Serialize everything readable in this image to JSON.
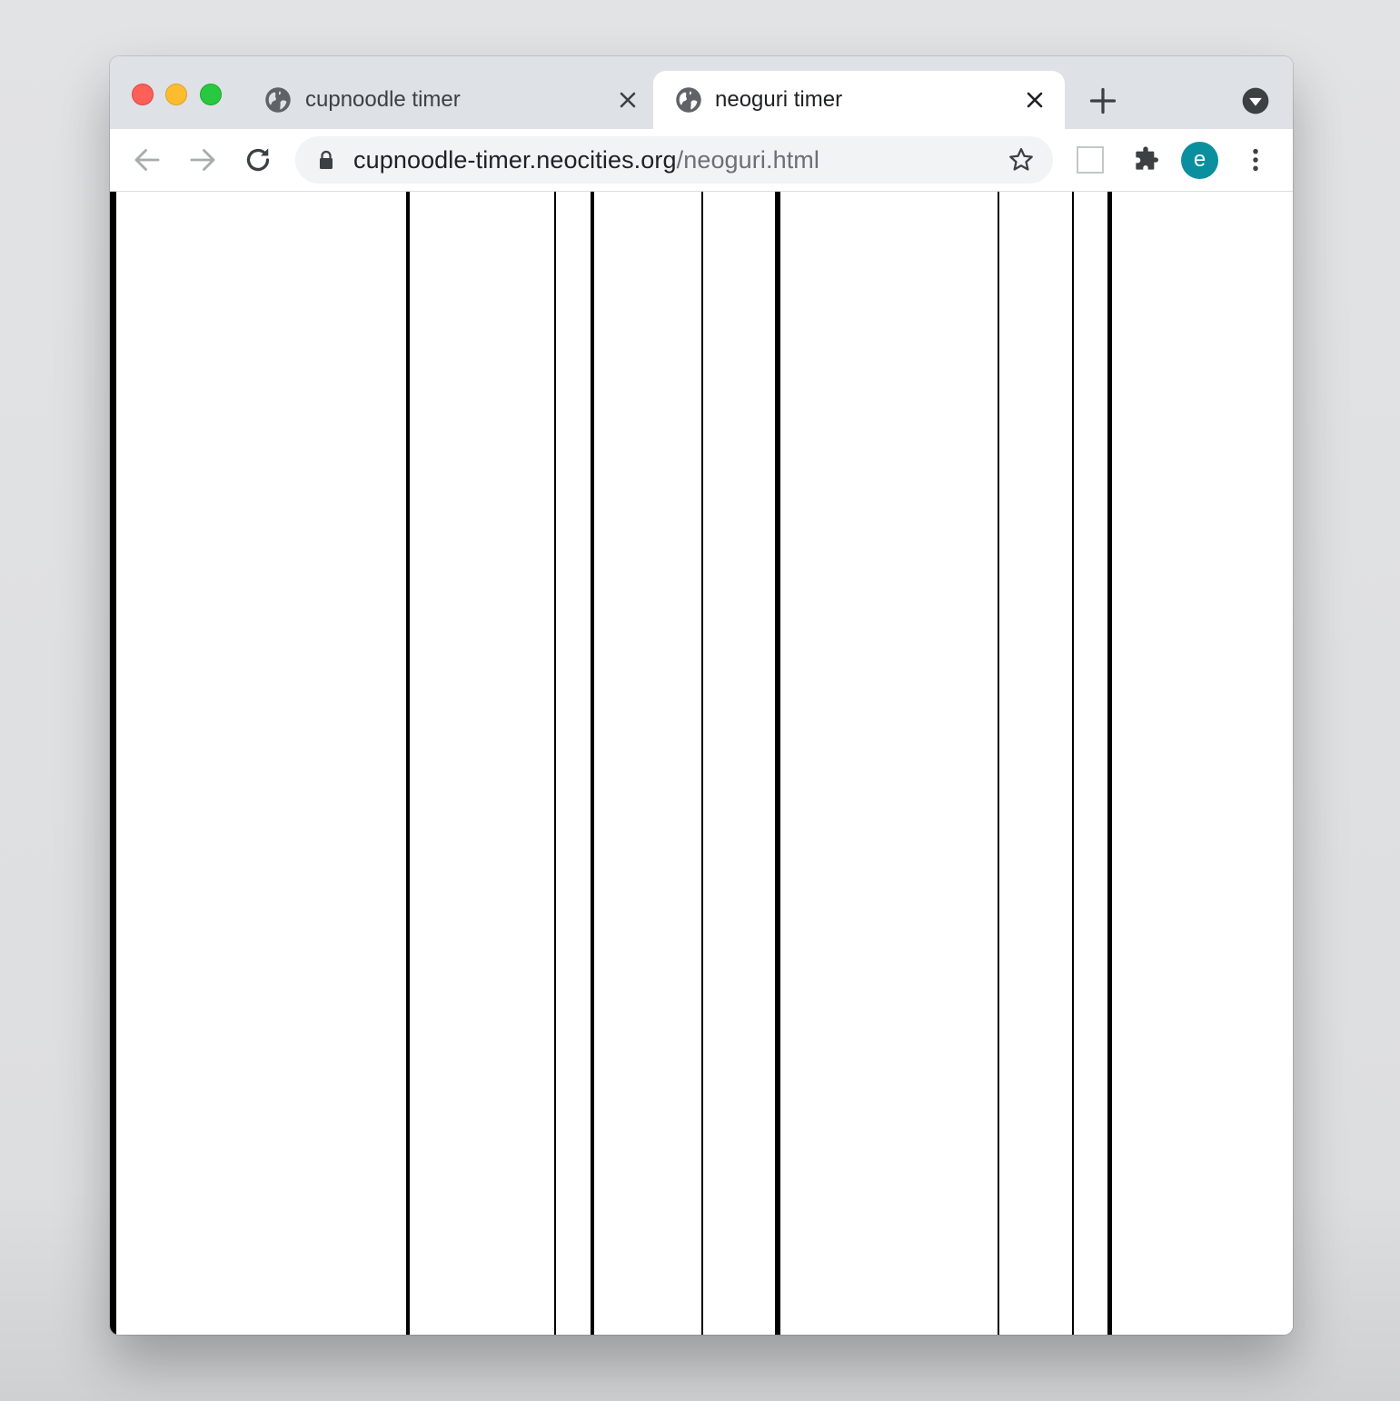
{
  "window": {
    "controls": [
      "close",
      "minimize",
      "maximize"
    ]
  },
  "tabs": [
    {
      "title": "cupnoodle timer",
      "icon": "globe-icon",
      "active": false
    },
    {
      "title": "neoguri timer",
      "icon": "globe-icon",
      "active": true
    }
  ],
  "toolbar": {
    "url_host": "cupnoodle-timer.neocities.org",
    "url_path": "/neoguri.html",
    "avatar_letter": "e",
    "avatar_color": "#0a8f9f"
  },
  "colors": {
    "tabstrip": "#dee1e6",
    "omnibox": "#f1f3f4",
    "line": "#000000"
  }
}
